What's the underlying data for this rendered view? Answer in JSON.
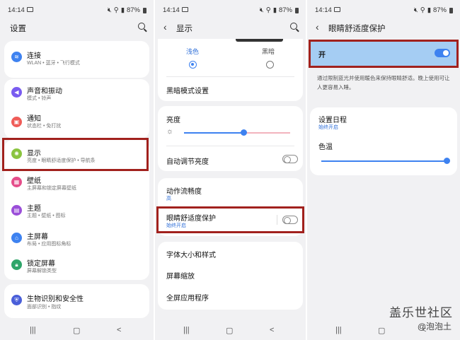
{
  "status": {
    "time": "14:14",
    "battery": "87%"
  },
  "panel1": {
    "title": "设置",
    "items": [
      {
        "label": "连接",
        "sub": "WLAN • 蓝牙 • 飞行模式",
        "icon": "wifi-icon",
        "color": "#3e82f0"
      },
      {
        "label": "声音和振动",
        "sub": "模式 • 铃声",
        "icon": "speaker-icon",
        "color": "#7a5cf0"
      },
      {
        "label": "通知",
        "sub": "状态栏 • 免打扰",
        "icon": "notification-icon",
        "color": "#ef5c58"
      },
      {
        "label": "显示",
        "sub": "亮度 • 眼睛舒适度保护 • 导航条",
        "icon": "sun-icon",
        "color": "#8ac43f"
      },
      {
        "label": "壁纸",
        "sub": "主屏幕和锁定屏幕壁纸",
        "icon": "wallpaper-icon",
        "color": "#e54e8a"
      },
      {
        "label": "主题",
        "sub": "主题 • 壁纸 • 图标",
        "icon": "theme-icon",
        "color": "#9b4fd9"
      },
      {
        "label": "主屏幕",
        "sub": "布局 • 应用图标角标",
        "icon": "home-icon",
        "color": "#3e82f0"
      },
      {
        "label": "锁定屏幕",
        "sub": "屏幕解锁类型",
        "icon": "lock-icon",
        "color": "#2fa56a"
      },
      {
        "label": "生物识别和安全性",
        "sub": "面部识别 • 指纹",
        "icon": "shield-icon",
        "color": "#4a5fd9"
      }
    ]
  },
  "panel2": {
    "title": "显示",
    "mode_light": "浅色",
    "mode_dark": "黑暗",
    "dark_settings": "黑暗模式设置",
    "brightness": "亮度",
    "brightness_level": 0.56,
    "auto_brightness": "自动调节亮度",
    "motion": "动作流畅度",
    "motion_value": "高",
    "eye_comfort": "眼睛舒适度保护",
    "eye_comfort_sub": "始终开启",
    "font": "字体大小和样式",
    "zoom": "屏幕缩放",
    "fullscreen": "全屏应用程序"
  },
  "panel3": {
    "title": "眼睛舒适度保护",
    "on_label": "开",
    "description": "通过限制蓝光并使用暖色来保持眼睛舒适。晚上使用可让人更容易入睡。",
    "schedule": "设置日程",
    "schedule_value": "始终开启",
    "color_temp": "色温",
    "color_temp_level": 1.0
  },
  "watermark": {
    "brand": "盖乐世社区",
    "handle": "@泡泡土"
  },
  "colors": {
    "accent": "#3e82f0",
    "highlight_border": "#a1211d",
    "active_bg": "#a5cdf3"
  }
}
